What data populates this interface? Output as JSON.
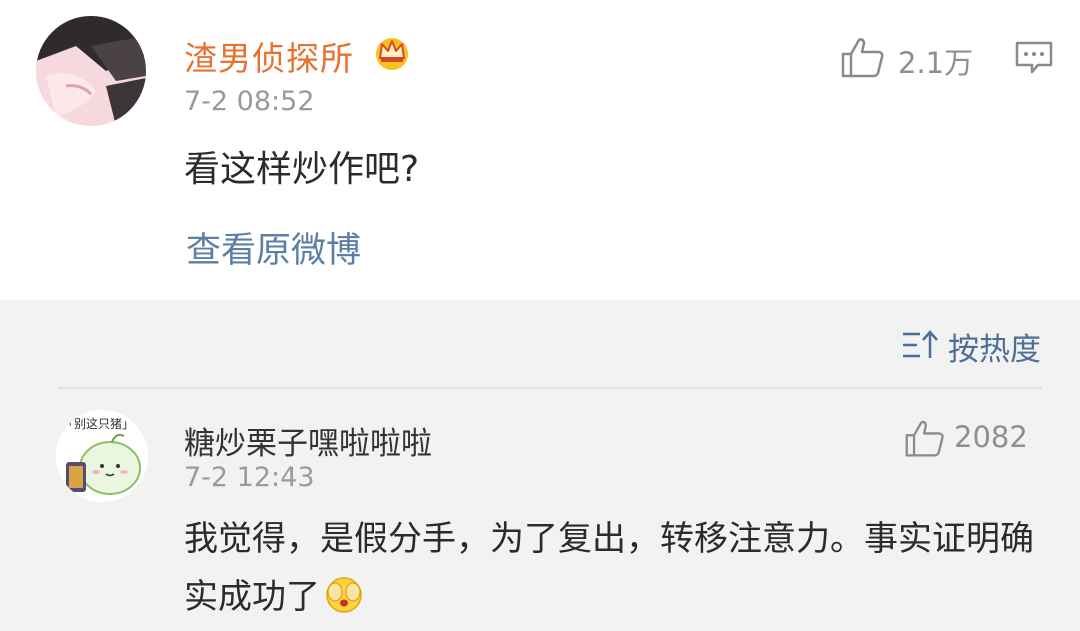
{
  "post": {
    "username": "渣男侦探所",
    "time": "7-2 08:52",
    "like_count": "2.1万",
    "content": "看这样炒作吧?",
    "view_original": "查看原微博"
  },
  "sort": {
    "label": "按热度"
  },
  "comment": {
    "username": "糖炒栗子嘿啦啦啦",
    "time": "7-2 12:43",
    "like_count": "2082",
    "content": "我觉得，是假分手，为了复出，转移注意力。事实证明确实成功了",
    "avatar_caption": "「别这只猪」"
  },
  "colors": {
    "vip_name": "#e8712f",
    "link": "#5b7fa6",
    "sort": "#4d6f96"
  }
}
